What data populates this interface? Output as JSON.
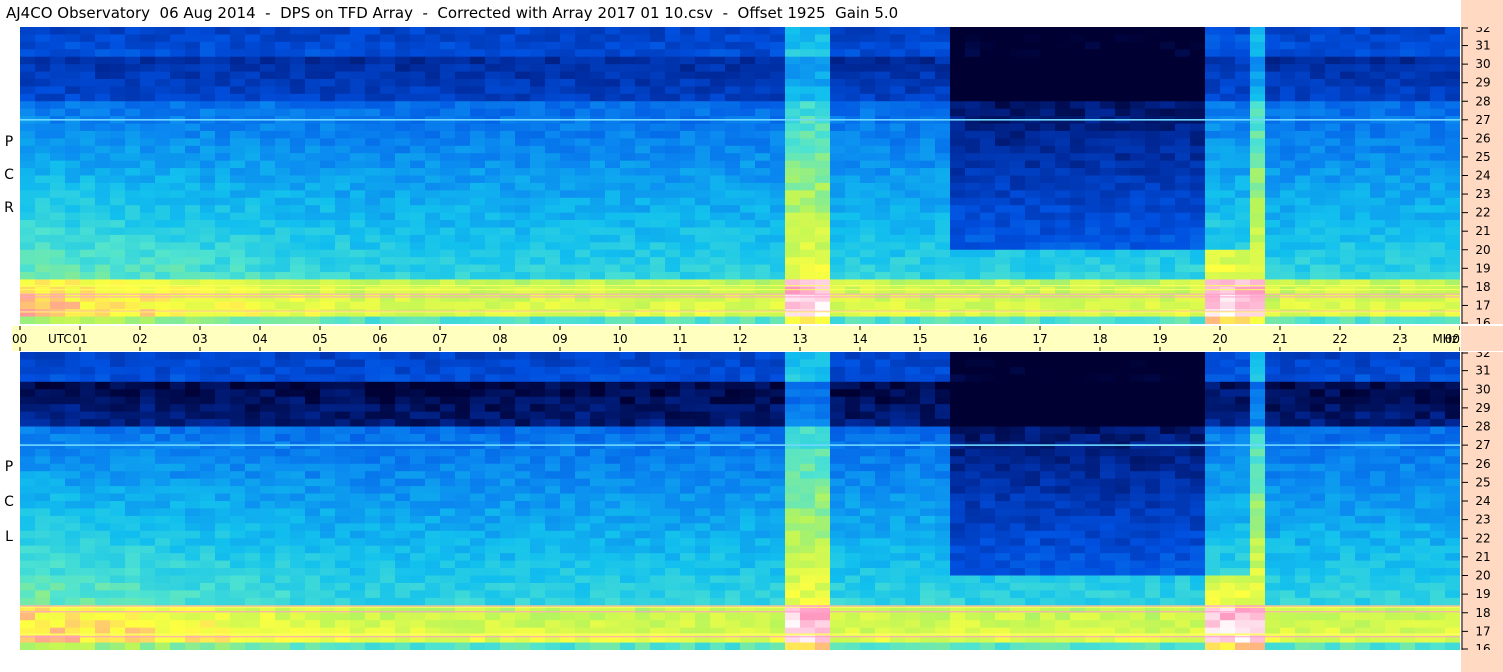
{
  "title": "AJ4CO Observatory  06 Aug 2014  -  DPS on TFD Array  -  Corrected with Array 2017 01 10.csv  -  Offset 1925  Gain 5.0",
  "panels": {
    "top": {
      "label_letters": [
        "P",
        "C",
        "R"
      ],
      "polarization": "RCP"
    },
    "bottom": {
      "label_letters": [
        "P",
        "C",
        "L"
      ],
      "polarization": "LCP"
    }
  },
  "colors": {
    "axis_band": "#ffffc0",
    "freq_band": "#ffd9c2",
    "colormap": [
      "#000033",
      "#002a9c",
      "#0050e0",
      "#0a86f0",
      "#12c0ee",
      "#4fe3d0",
      "#b8f55a",
      "#ffff40",
      "#ff7fb0",
      "#ffffff"
    ]
  },
  "chart_data": {
    "type": "heatmap",
    "title": "AJ4CO Observatory  06 Aug 2014  -  DPS on TFD Array  -  Corrected with Array 2017 01 10.csv  -  Offset 1925  Gain 5.0",
    "x_unit_label": "UTC",
    "y_unit_label": "MHz",
    "x_tick_labels": [
      "00",
      "01",
      "02",
      "03",
      "04",
      "05",
      "06",
      "07",
      "08",
      "09",
      "10",
      "11",
      "12",
      "13",
      "14",
      "15",
      "16",
      "17",
      "18",
      "19",
      "20",
      "21",
      "22",
      "23",
      "00"
    ],
    "xlim_hours": [
      0,
      24
    ],
    "y_tick_labels": [
      "16",
      "17",
      "18",
      "19",
      "20",
      "21",
      "22",
      "23",
      "24",
      "25",
      "26",
      "27",
      "28",
      "29",
      "30",
      "31",
      "32"
    ],
    "ylim_mhz": [
      16,
      32
    ],
    "panels": [
      "RCP",
      "LCP"
    ],
    "features": {
      "high_intensity_band_mhz": [
        16.5,
        18.5
      ],
      "interference_line_mhz": 27,
      "wideband_bursts_utc_hours": [
        [
          12.75,
          13.5
        ],
        [
          19.8,
          20.7
        ]
      ],
      "quiet_region_utc_hours": [
        15.5,
        20.5
      ]
    }
  }
}
